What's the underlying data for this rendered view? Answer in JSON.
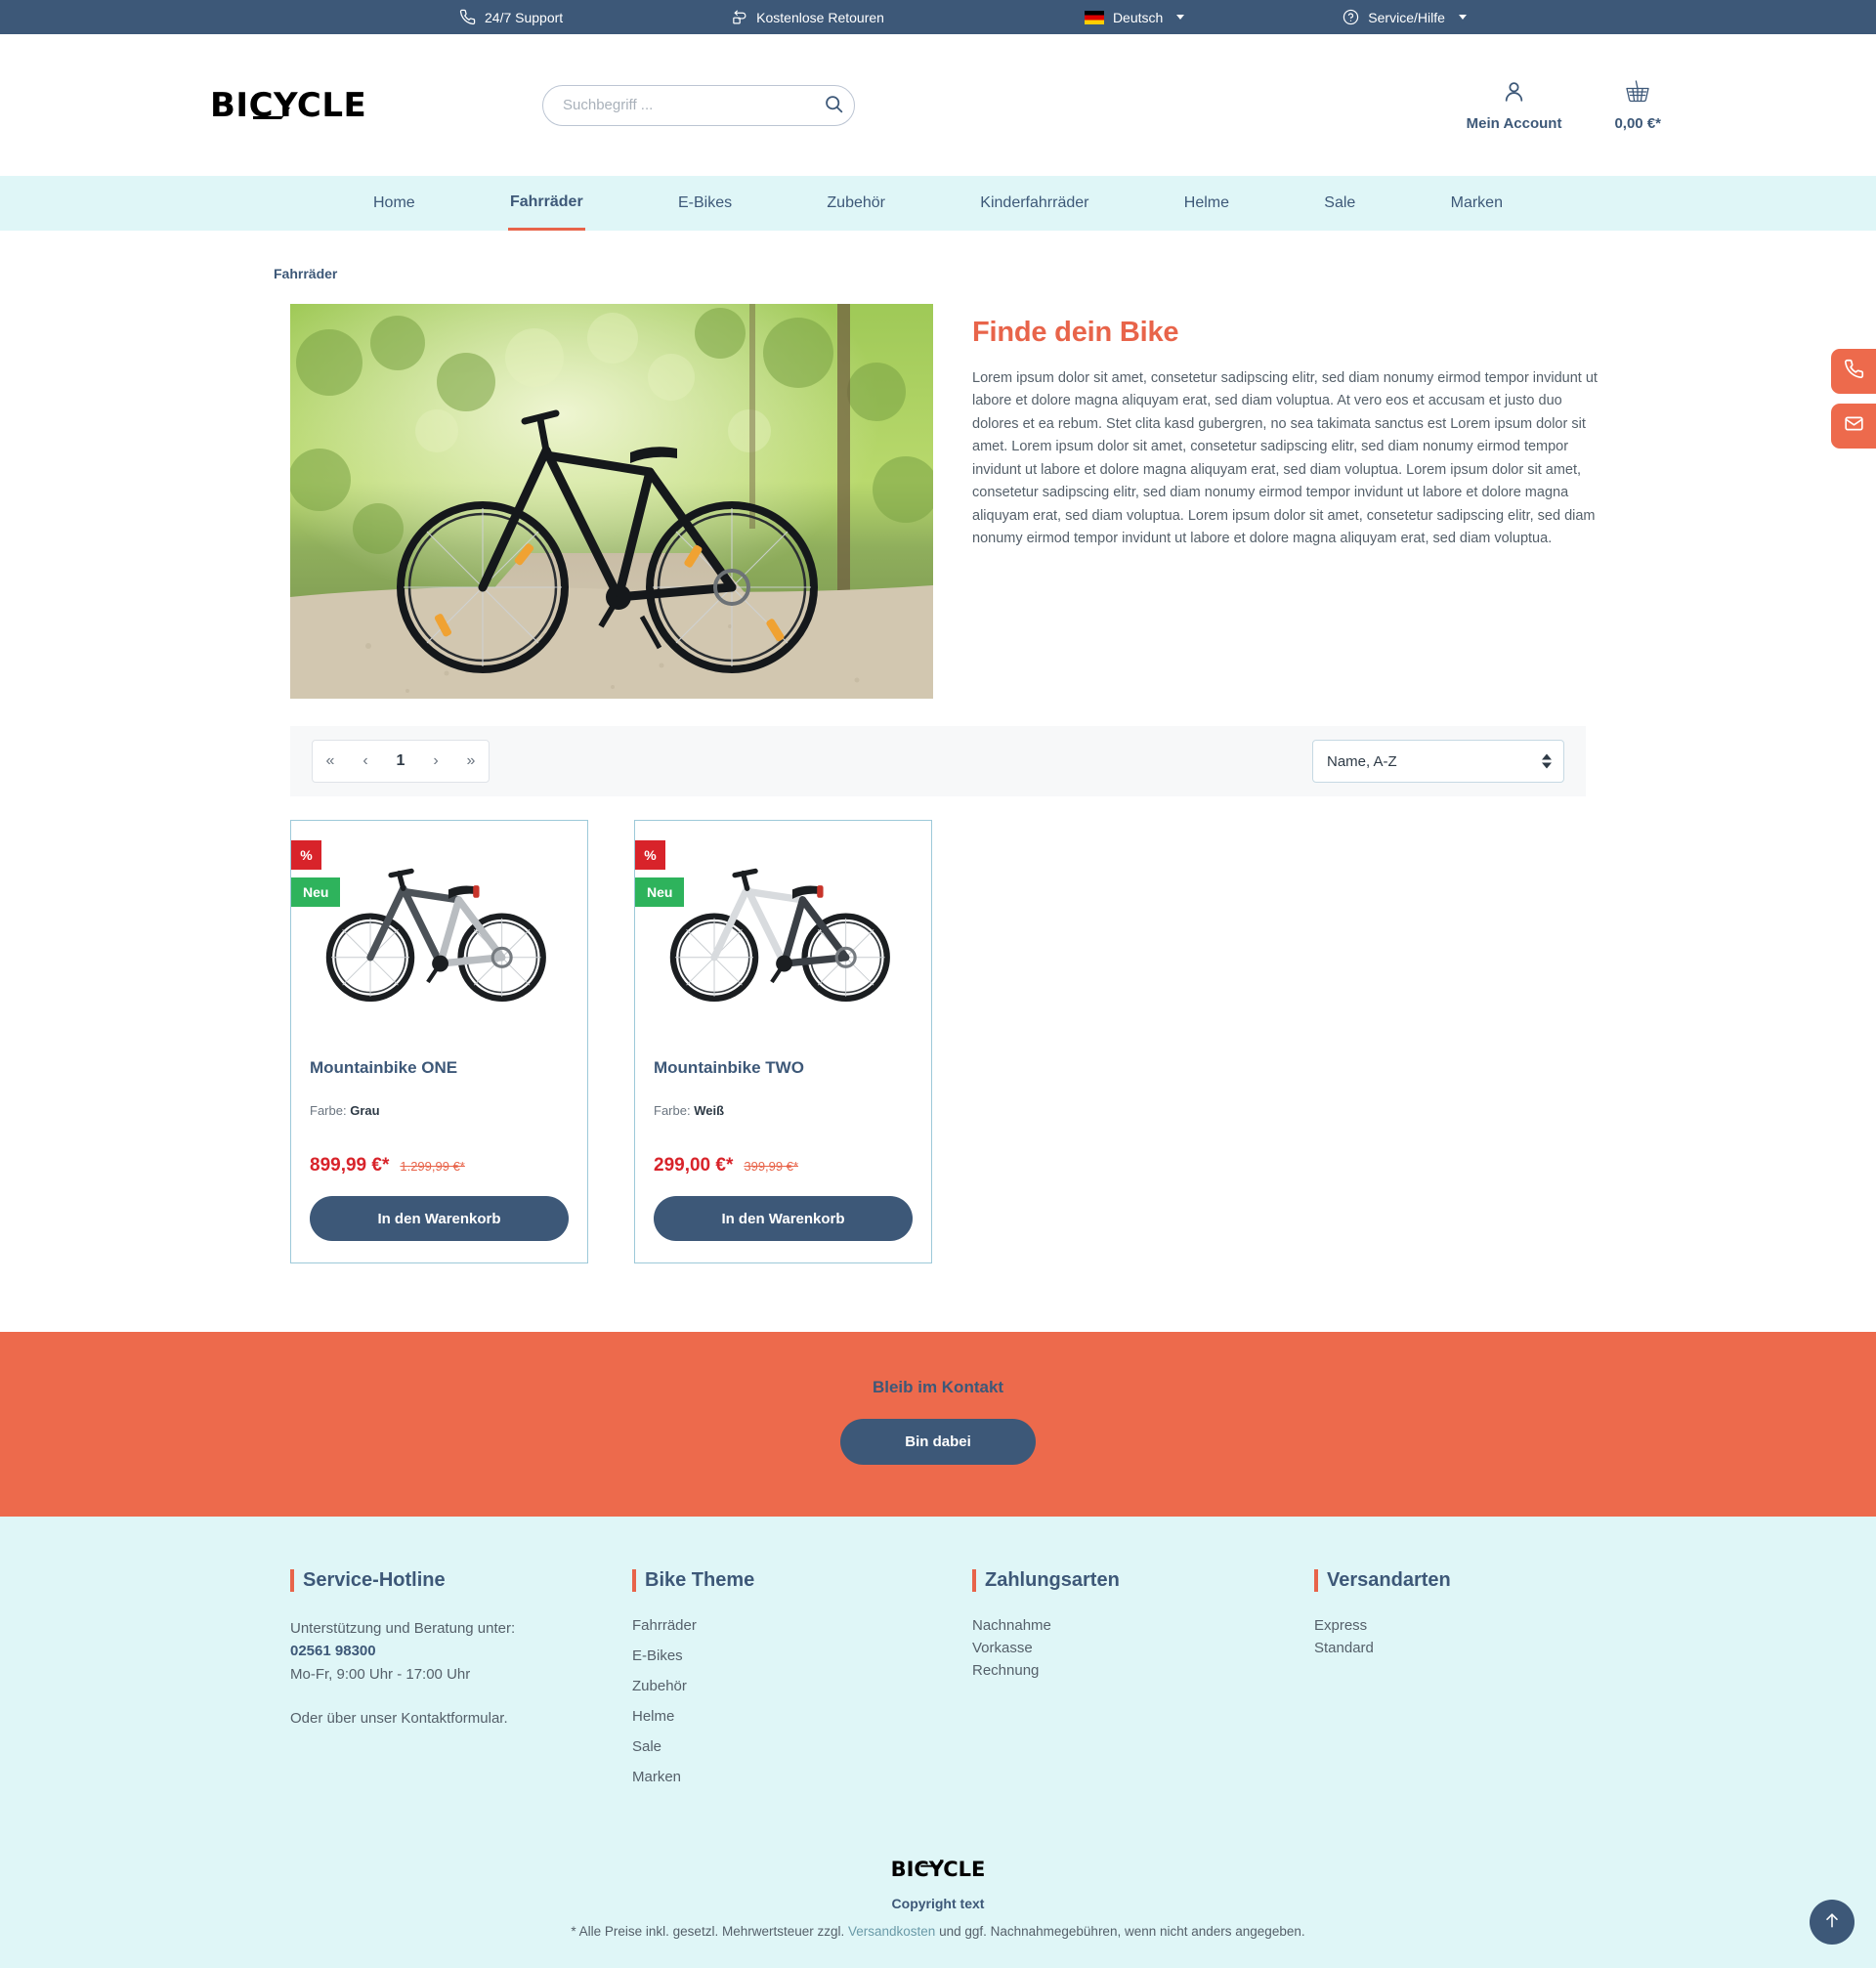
{
  "colors": {
    "topbar_bg": "#3d5878",
    "primary": "#3d5878",
    "accent": "#e8644a",
    "newsletter_bg": "#ed6a4c",
    "nav_bg": "#dff6f7",
    "footer_bg": "#dff6f7",
    "price": "#d8232a",
    "badge_sale": "#d8232a",
    "badge_new": "#2eb35c"
  },
  "topbar": {
    "support": "24/7 Support",
    "returns": "Kostenlose Retouren",
    "language": "Deutsch",
    "service": "Service/Hilfe"
  },
  "header": {
    "logo": "BICYCLE",
    "search_placeholder": "Suchbegriff ...",
    "search_value": "",
    "account_label": "Mein Account",
    "cart_total": "0,00 €*"
  },
  "nav": {
    "items": [
      {
        "label": "Home",
        "active": false
      },
      {
        "label": "Fahrräder",
        "active": true
      },
      {
        "label": "E-Bikes",
        "active": false
      },
      {
        "label": "Zubehör",
        "active": false
      },
      {
        "label": "Kinderfahrräder",
        "active": false
      },
      {
        "label": "Helme",
        "active": false
      },
      {
        "label": "Sale",
        "active": false
      },
      {
        "label": "Marken",
        "active": false
      }
    ]
  },
  "breadcrumb": "Fahrräder",
  "hero": {
    "title": "Finde dein Bike",
    "body": "Lorem ipsum dolor sit amet, consetetur sadipscing elitr, sed diam nonumy eirmod tempor invidunt ut labore et dolore magna aliquyam erat, sed diam voluptua. At vero eos et accusam et justo duo dolores et ea rebum. Stet clita kasd gubergren, no sea takimata sanctus est Lorem ipsum dolor sit amet. Lorem ipsum dolor sit amet, consetetur sadipscing elitr, sed diam nonumy eirmod tempor invidunt ut labore et dolore magna aliquyam erat, sed diam voluptua.  Lorem ipsum dolor sit amet, consetetur sadipscing elitr, sed diam nonumy eirmod tempor invidunt ut labore et dolore magna aliquyam erat, sed diam voluptua. Lorem ipsum dolor sit amet, consetetur sadipscing elitr, sed diam nonumy eirmod tempor invidunt ut labore et dolore magna aliquyam erat, sed diam voluptua."
  },
  "toolbar": {
    "pagination": {
      "first": "«",
      "prev": "‹",
      "current": "1",
      "next": "›",
      "last": "»"
    },
    "sort": {
      "selected": "Name, A-Z",
      "options": [
        "Name, A-Z"
      ]
    }
  },
  "products": [
    {
      "badge_sale": "%",
      "badge_new": "Neu",
      "title": "Mountainbike ONE",
      "variant_label": "Farbe:",
      "variant_value": "Grau",
      "price": "899,99 €*",
      "price_old": "1.299,99 €*",
      "cart_label": "In den Warenkorb",
      "frame_color": "#4c5258",
      "accent_color": "#b9bdc1"
    },
    {
      "badge_sale": "%",
      "badge_new": "Neu",
      "title": "Mountainbike TWO",
      "variant_label": "Farbe:",
      "variant_value": "Weiß",
      "price": "299,00 €*",
      "price_old": "399,99 €*",
      "cart_label": "In den Warenkorb",
      "frame_color": "#d8dbde",
      "accent_color": "#3b4046"
    }
  ],
  "newsletter": {
    "title": "Bleib im Kontakt",
    "button": "Bin dabei"
  },
  "footer": {
    "col1": {
      "title": "Service-Hotline",
      "line1": "Unterstützung und Beratung unter:",
      "phone": "02561 98300",
      "hours": "Mo-Fr, 9:00 Uhr - 17:00 Uhr",
      "contact_prefix": "Oder über unser ",
      "contact_link": "Kontaktformular",
      "contact_suffix": "."
    },
    "col2": {
      "title": "Bike Theme",
      "links": [
        "Fahrräder",
        "E-Bikes",
        "Zubehör",
        "Helme",
        "Sale",
        "Marken"
      ]
    },
    "col3": {
      "title": "Zahlungsarten",
      "links": [
        "Nachnahme",
        "Vorkasse",
        "Rechnung"
      ]
    },
    "col4": {
      "title": "Versandarten",
      "links": [
        "Express",
        "Standard"
      ]
    },
    "logo": "BICYCLE",
    "copyright": "Copyright text",
    "vat_prefix": "* Alle Preise inkl. gesetzl. Mehrwertsteuer zzgl. ",
    "vat_link": "Versandkosten",
    "vat_suffix": " und ggf. Nachnahmegebühren, wenn nicht anders angegeben."
  }
}
